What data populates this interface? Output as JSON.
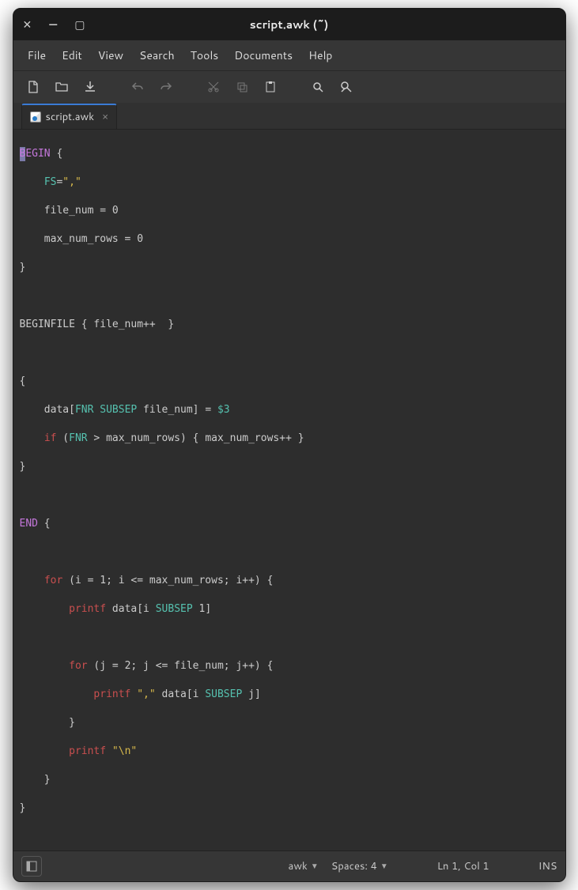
{
  "window": {
    "title": "script.awk (~)"
  },
  "menu": {
    "file": "File",
    "edit": "Edit",
    "view": "View",
    "search": "Search",
    "tools": "Tools",
    "documents": "Documents",
    "help": "Help"
  },
  "tab": {
    "label": "script.awk"
  },
  "code": {
    "l1a": "B",
    "l1b": "EGIN",
    "l1c": " {",
    "l2a": "    ",
    "l2b": "FS",
    "l2c": "=",
    "l2d": "\",\"",
    "l3": "    file_num = 0",
    "l4": "    max_num_rows = 0",
    "l5": "}",
    "l6": "",
    "l7": "BEGINFILE { file_num++  }",
    "l8": "",
    "l9": "{",
    "l10a": "    data[",
    "l10b": "FNR",
    "l10c": " ",
    "l10d": "SUBSEP",
    "l10e": " file_num] = ",
    "l10f": "$3",
    "l11a": "    ",
    "l11b": "if",
    "l11c": " (",
    "l11d": "FNR",
    "l11e": " > max_num_rows) { max_num_rows++ }",
    "l12": "}",
    "l13": "",
    "l14a": "END",
    "l14b": " {",
    "l15": "",
    "l16a": "    ",
    "l16b": "for",
    "l16c": " (i = 1; i <= max_num_rows; i++) {",
    "l17a": "        ",
    "l17b": "printf",
    "l17c": " data[i ",
    "l17d": "SUBSEP",
    "l17e": " 1]",
    "l18": "",
    "l19a": "        ",
    "l19b": "for",
    "l19c": " (j = 2; j <= file_num; j++) {",
    "l20a": "            ",
    "l20b": "printf",
    "l20c": " ",
    "l20d": "\",\"",
    "l20e": " data[i ",
    "l20f": "SUBSEP",
    "l20g": " j]",
    "l21": "        }",
    "l22a": "        ",
    "l22b": "printf",
    "l22c": " ",
    "l22d": "\"\\n\"",
    "l23": "    }",
    "l24": "}"
  },
  "status": {
    "syntax": "awk",
    "spaces": "Spaces: 4",
    "pos": "Ln 1, Col 1",
    "mode": "INS"
  }
}
